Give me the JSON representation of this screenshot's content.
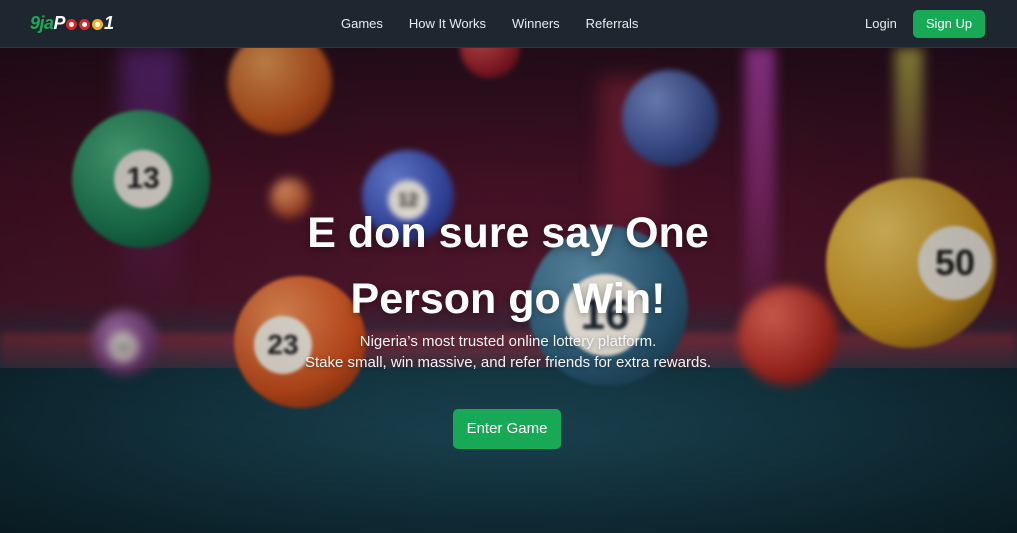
{
  "logo": {
    "part1": "9ja",
    "part2": "P",
    "part3": "1"
  },
  "nav": {
    "items": [
      {
        "label": "Games"
      },
      {
        "label": "How It Works"
      },
      {
        "label": "Winners"
      },
      {
        "label": "Referrals"
      }
    ],
    "login_label": "Login",
    "signup_label": "Sign Up"
  },
  "hero": {
    "title_line1": "E don sure say One",
    "title_line2": "Person go Win!",
    "subtitle_line1": "Nigeria’s most trusted online lottery platform.",
    "subtitle_line2": "Stake small, win massive, and refer friends for extra rewards.",
    "cta_label": "Enter Game",
    "background_balls": [
      {
        "number": "13"
      },
      {
        "number": "12"
      },
      {
        "number": "16"
      },
      {
        "number": "50"
      },
      {
        "number": "23"
      },
      {
        "number": "14"
      }
    ]
  },
  "colors": {
    "navbar_bg": "#1e262f",
    "accent_green": "#18a957",
    "text_white": "#ffffff"
  }
}
